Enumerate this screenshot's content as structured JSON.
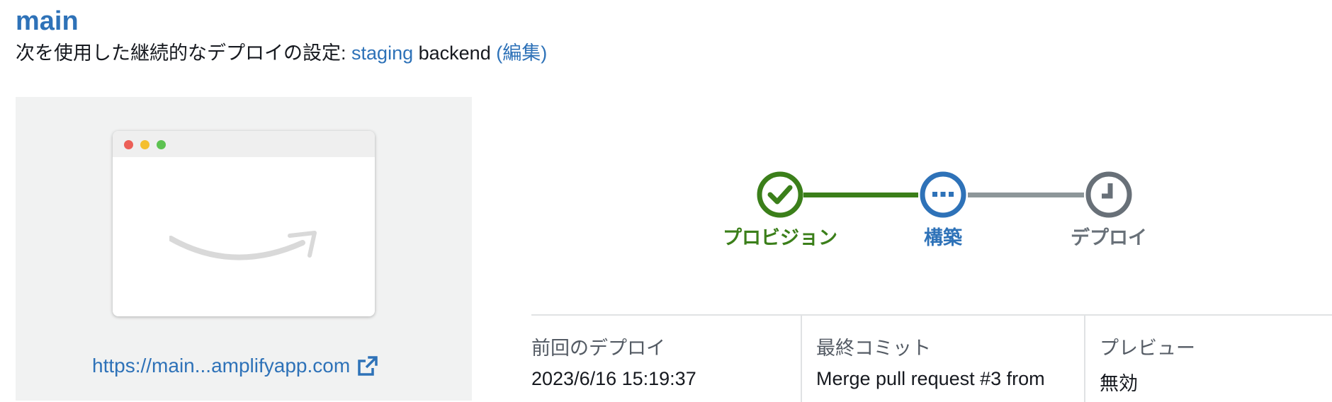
{
  "branch": {
    "name": "main",
    "subtitle_prefix": "次を使用した継続的なデプロイの設定:",
    "env_link": "staging",
    "env_suffix": "backend",
    "edit_link": "(編集)"
  },
  "preview": {
    "url": "https://main...amplifyapp.com",
    "browser_icon": "browser-window-icon",
    "logo_icon": "amazon-smile-icon",
    "external_icon": "external-link-icon"
  },
  "pipeline": {
    "steps": [
      {
        "label": "プロビジョン",
        "status": "completed",
        "icon": "check-circle-icon",
        "color": "#3b7f1a"
      },
      {
        "label": "構築",
        "status": "in-progress",
        "icon": "in-progress-icon",
        "color": "#2e72b8"
      },
      {
        "label": "デプロイ",
        "status": "pending",
        "icon": "clock-icon",
        "color": "#687078"
      }
    ]
  },
  "details": {
    "last_deploy_label": "前回のデプロイ",
    "last_deploy_value": "2023/6/16 15:19:37",
    "last_commit_label": "最終コミット",
    "last_commit_value": "Merge pull request #3 from",
    "preview_label": "プレビュー",
    "preview_value": "無効"
  },
  "colors": {
    "link": "#2e72b8",
    "success": "#3b7f1a",
    "pending": "#687078",
    "connector_pending": "#8d9699"
  }
}
